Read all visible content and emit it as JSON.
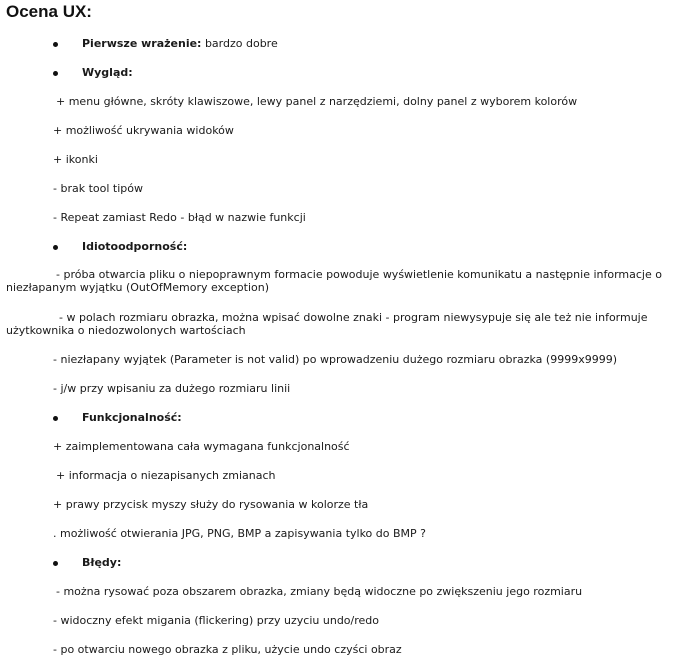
{
  "title": "Ocena UX:",
  "sections": {
    "first_impression": {
      "label": "Pierwsze wrażenie:",
      "value": " bardzo dobre"
    },
    "appearance": {
      "label": "Wygląd:",
      "items": [
        "+ menu główne, skróty klawiszowe, lewy panel z narzędziemi, dolny panel z wyborem kolorów",
        "+ możliwość ukrywania widoków",
        "+ ikonki",
        "- brak tool tipów",
        "- Repeat zamiast Redo - błąd w nazwie funkcji"
      ]
    },
    "robustness": {
      "label": "Idiotoodporność:",
      "items": [
        "- próba otwarcia pliku o niepoprawnym formacie powoduje wyświetlenie komunikatu a następnie informacje o niezłapanym wyjątku (OutOfMemory exception)",
        "- w polach rozmiaru obrazka, można wpisać dowolne znaki - program niewysypuje się ale też nie informuje użytkownika o niedozwolonych wartościach",
        "- niezłapany wyjątek (Parameter is not valid) po wprowadzeniu dużego rozmiaru obrazka (9999x9999)",
        "- j/w przy wpisaniu za dużego rozmiaru linii"
      ]
    },
    "functionality": {
      "label": "Funkcjonalność:",
      "items": [
        "+ zaimplementowana cała wymagana funkcjonalność",
        "+ informacja o niezapisanych zmianach",
        "+ prawy przycisk myszy służy do rysowania w kolorze tła",
        ". możliwość otwierania JPG, PNG, BMP a zapisywania tylko do BMP ?"
      ]
    },
    "errors": {
      "label": "Błędy:",
      "items": [
        "- można rysować poza obszarem obrazka, zmiany będą widoczne po zwiększeniu jego rozmiaru",
        "- widoczny efekt migania (flickering) przy uzyciu undo/redo",
        "- po otwarciu nowego obrazka z pliku, użycie undo czyści obraz"
      ]
    }
  }
}
